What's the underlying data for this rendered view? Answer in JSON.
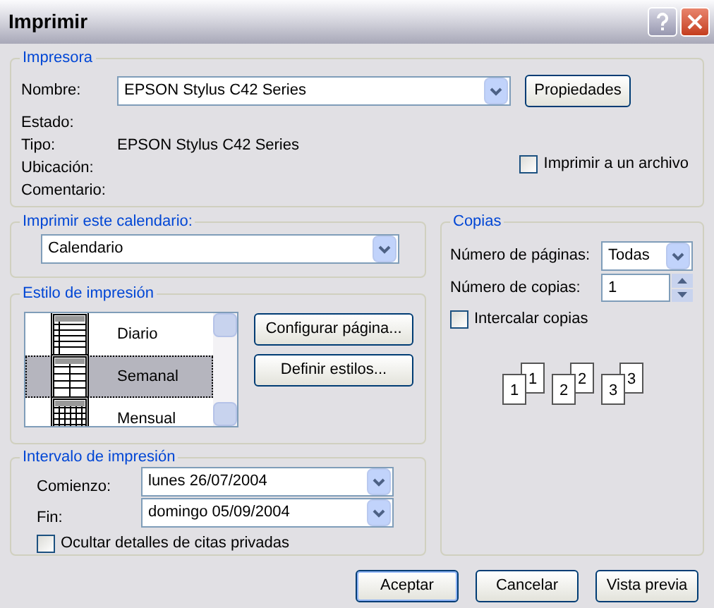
{
  "window": {
    "title": "Imprimir"
  },
  "printer": {
    "legend": "Impresora",
    "name_label": "Nombre:",
    "name_value": "EPSON Stylus C42 Series",
    "properties_button": "Propiedades",
    "fields": [
      {
        "label": "Estado:"
      },
      {
        "label": "Tipo:",
        "value": "EPSON Stylus C42 Series"
      },
      {
        "label": "Ubicación:"
      },
      {
        "label": "Comentario:"
      }
    ],
    "print_to_file": {
      "label": "Imprimir a un archivo",
      "checked": false
    }
  },
  "calendar": {
    "legend": "Imprimir este calendario:",
    "value": "Calendario"
  },
  "print_style": {
    "legend": "Estilo de impresión",
    "items": [
      {
        "label": "Diario",
        "kind": "daily",
        "selected": false
      },
      {
        "label": "Semanal",
        "kind": "weekly",
        "selected": true
      },
      {
        "label": "Mensual",
        "kind": "monthly",
        "selected": false
      }
    ],
    "buttons": [
      "Configurar página...",
      "Definir estilos..."
    ]
  },
  "range": {
    "legend": "Intervalo de impresión",
    "start_label": "Comienzo:",
    "start_value": "lunes 26/07/2004",
    "end_label": "Fin:",
    "end_value": "domingo 05/09/2004",
    "hide_private": {
      "label": "Ocultar detalles de citas privadas",
      "checked": false
    }
  },
  "copies": {
    "legend": "Copias",
    "pages_label": "Número de páginas:",
    "pages_value": "Todas",
    "copies_label": "Número de copias:",
    "copies_value": "1",
    "collate": {
      "label": "Intercalar copias",
      "checked": false
    },
    "collate_pages": [
      {
        "front": "1",
        "back": "1"
      },
      {
        "front": "2",
        "back": "2"
      },
      {
        "front": "3",
        "back": "3"
      }
    ]
  },
  "buttons": [
    {
      "label": "Aceptar",
      "default": true
    },
    {
      "label": "Cancelar",
      "default": false
    },
    {
      "label": "Vista previa",
      "default": false
    }
  ]
}
